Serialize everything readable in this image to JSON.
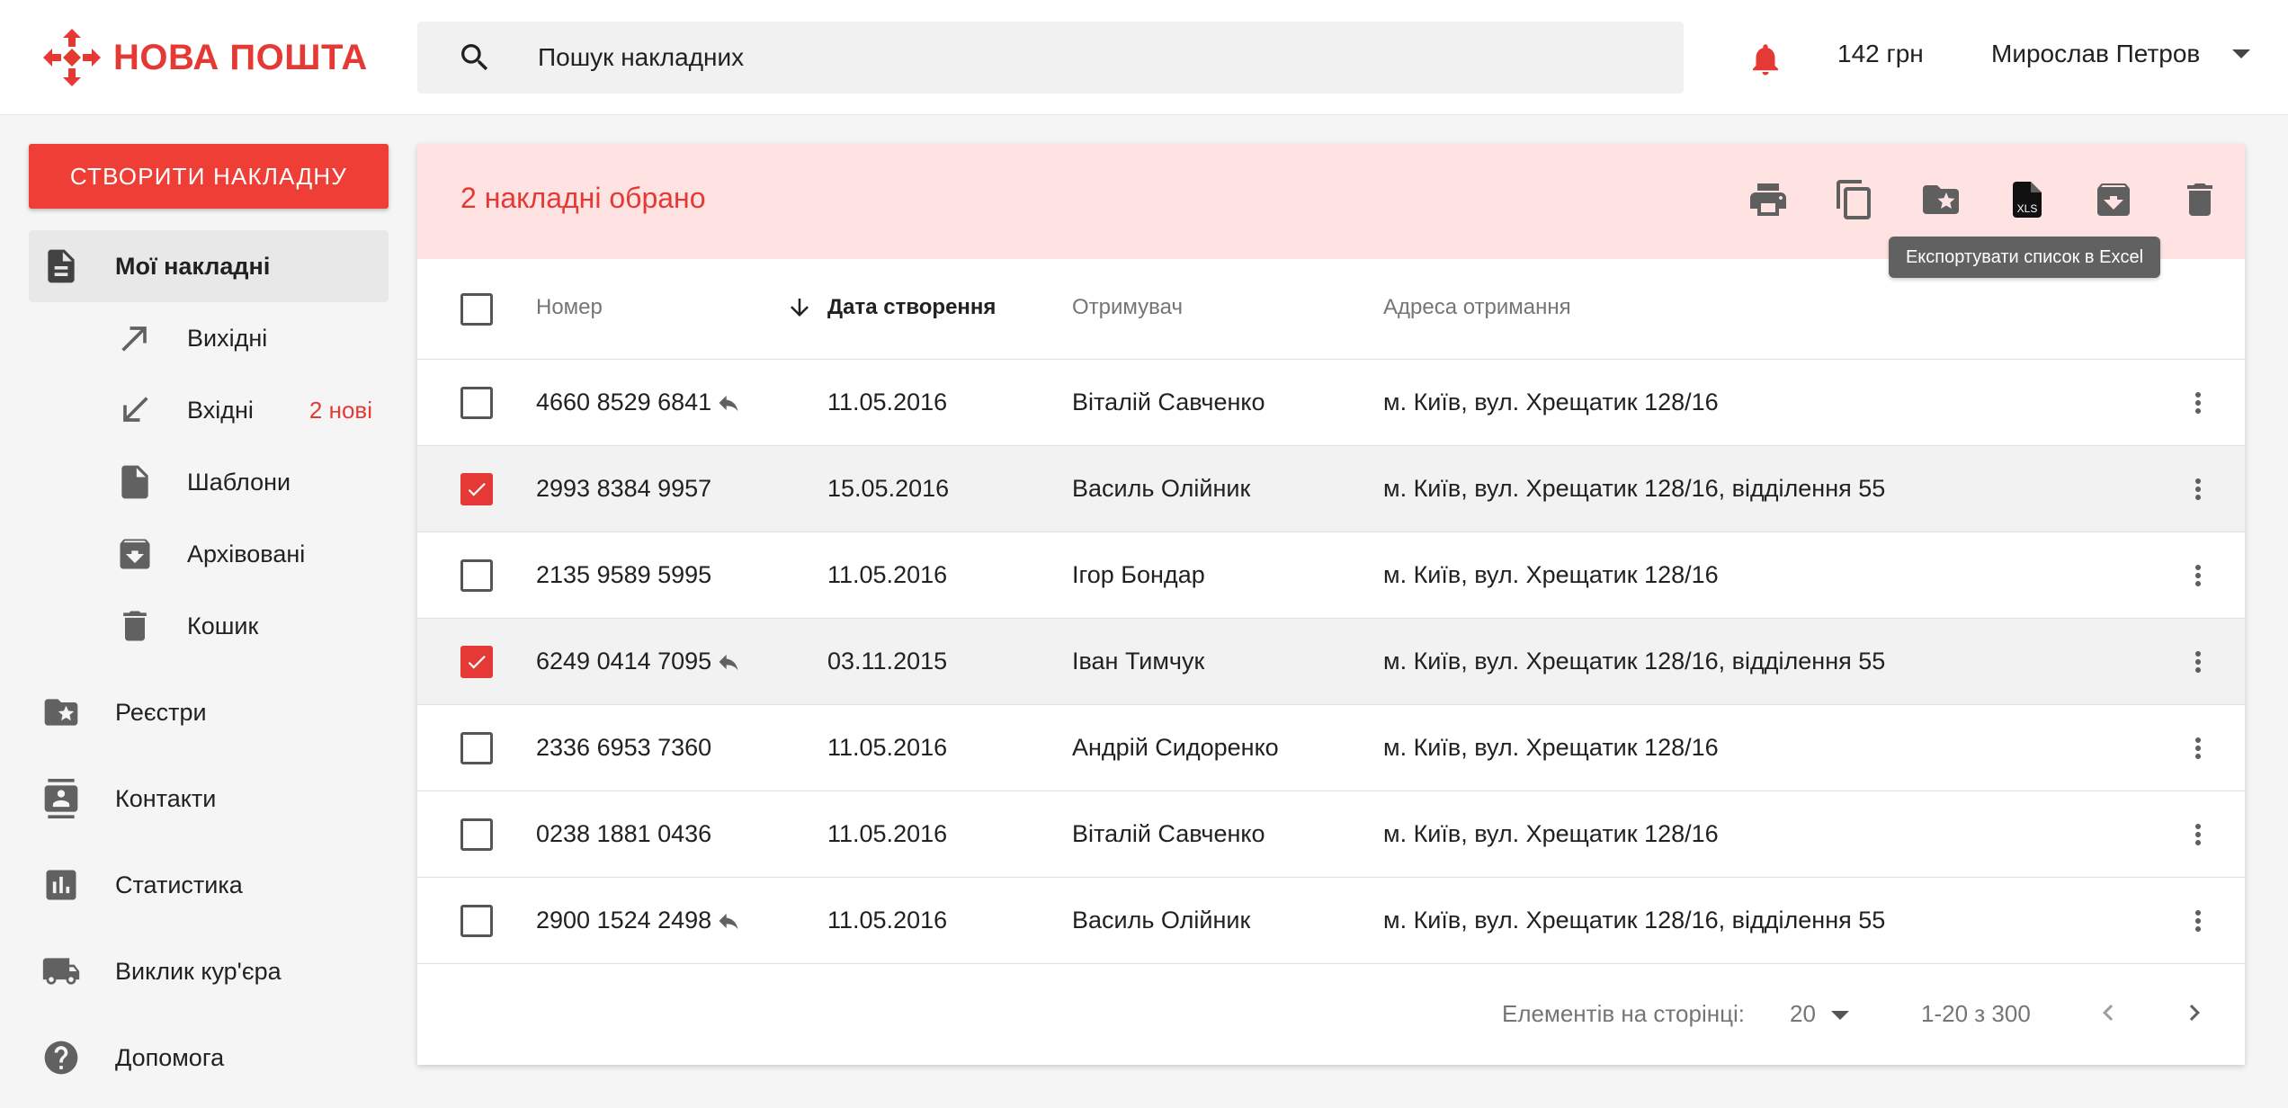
{
  "header": {
    "logo_text": "НОВА ПОШТА",
    "search_placeholder": "Пошук накладних",
    "balance": "142 грн",
    "user_name": "Мирослав Петров"
  },
  "sidebar": {
    "create_label": "СТВОРИТИ НАКЛАДНУ",
    "items": [
      {
        "label": "Мої накладні",
        "icon": "document-icon",
        "active": true
      },
      {
        "label": "Вихідні",
        "icon": "arrow-outgoing-icon"
      },
      {
        "label": "Вхідні",
        "icon": "arrow-incoming-icon",
        "badge": "2 нові"
      },
      {
        "label": "Шаблони",
        "icon": "template-file-icon"
      },
      {
        "label": "Архівовані",
        "icon": "archive-icon"
      },
      {
        "label": "Кошик",
        "icon": "trash-icon"
      },
      {
        "label": "Реєстри",
        "icon": "folder-star-icon"
      },
      {
        "label": "Контакти",
        "icon": "contacts-icon"
      },
      {
        "label": "Статистика",
        "icon": "stats-icon"
      },
      {
        "label": "Виклик кур'єра",
        "icon": "truck-icon"
      },
      {
        "label": "Допомога",
        "icon": "help-icon"
      }
    ]
  },
  "selection_bar": {
    "count_text": "2 накладні обрано",
    "tooltip": "Експортувати список в Excel",
    "xls_label": "XLS"
  },
  "table": {
    "columns": [
      "Номер",
      "Дата створення",
      "Отримувач",
      "Адреса отримання"
    ],
    "sorted_column": "Дата створення",
    "rows": [
      {
        "number": "4660 8529 6841",
        "reply": true,
        "date": "11.05.2016",
        "recipient": "Віталій Савченко",
        "address": "м. Київ, вул. Хрещатик 128/16",
        "checked": false
      },
      {
        "number": "2993 8384 9957",
        "reply": false,
        "date": "15.05.2016",
        "recipient": "Василь Олійник",
        "address": "м. Київ, вул. Хрещатик 128/16, відділення 55",
        "checked": true
      },
      {
        "number": "2135 9589 5995",
        "reply": false,
        "date": "11.05.2016",
        "recipient": "Ігор Бондар",
        "address": "м. Київ, вул. Хрещатик 128/16",
        "checked": false
      },
      {
        "number": "6249 0414 7095",
        "reply": true,
        "date": "03.11.2015",
        "recipient": "Іван Тимчук",
        "address": "м. Київ, вул. Хрещатик 128/16, відділення 55",
        "checked": true
      },
      {
        "number": "2336 6953 7360",
        "reply": false,
        "date": "11.05.2016",
        "recipient": "Андрій Сидоренко",
        "address": "м. Київ, вул. Хрещатик 128/16",
        "checked": false
      },
      {
        "number": "0238 1881 0436",
        "reply": false,
        "date": "11.05.2016",
        "recipient": "Віталій Савченко",
        "address": "м. Київ, вул. Хрещатик 128/16",
        "checked": false
      },
      {
        "number": "2900 1524 2498",
        "reply": true,
        "date": "11.05.2016",
        "recipient": "Василь Олійник",
        "address": "м. Київ, вул. Хрещатик 128/16, відділення 55",
        "checked": false
      }
    ]
  },
  "pagination": {
    "per_page_label": "Елементів на сторінці:",
    "per_page_value": "20",
    "range": "1-20 з 300"
  },
  "colors": {
    "brand_red": "#E53935",
    "selection_bg": "#FFE3E3",
    "icon_gray": "#5F5F5F"
  }
}
